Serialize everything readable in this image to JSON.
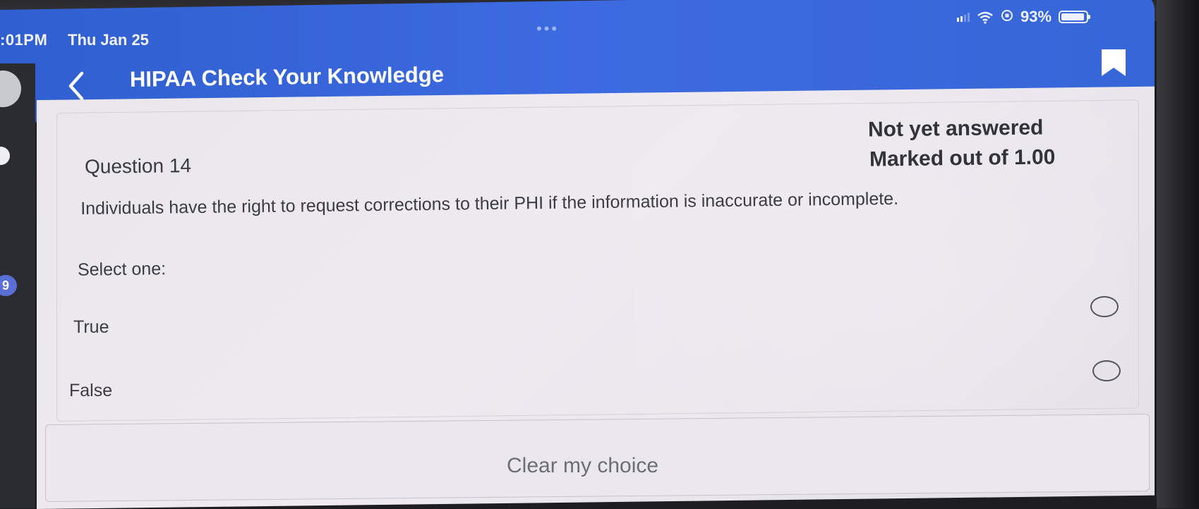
{
  "status_bar": {
    "time": ":01PM",
    "date": "Thu Jan 25",
    "battery_percent": "93%",
    "battery_level": 0.93
  },
  "header": {
    "title": "HIPAA Check Your Knowledge",
    "background_color": "#3563d8",
    "back_icon": "chevron-left-icon",
    "bookmark_icon": "bookmark-icon"
  },
  "sidebar": {
    "badge": "9"
  },
  "question": {
    "number_label": "Question 14",
    "status": "Not yet answered",
    "mark": "Marked out of 1.00",
    "text": "Individuals have the right to request corrections to their PHI if the information is inaccurate or incomplete.",
    "prompt": "Select one:",
    "options": [
      {
        "label": "True",
        "selected": false
      },
      {
        "label": "False",
        "selected": false
      }
    ]
  },
  "actions": {
    "clear_label": "Clear my choice"
  }
}
